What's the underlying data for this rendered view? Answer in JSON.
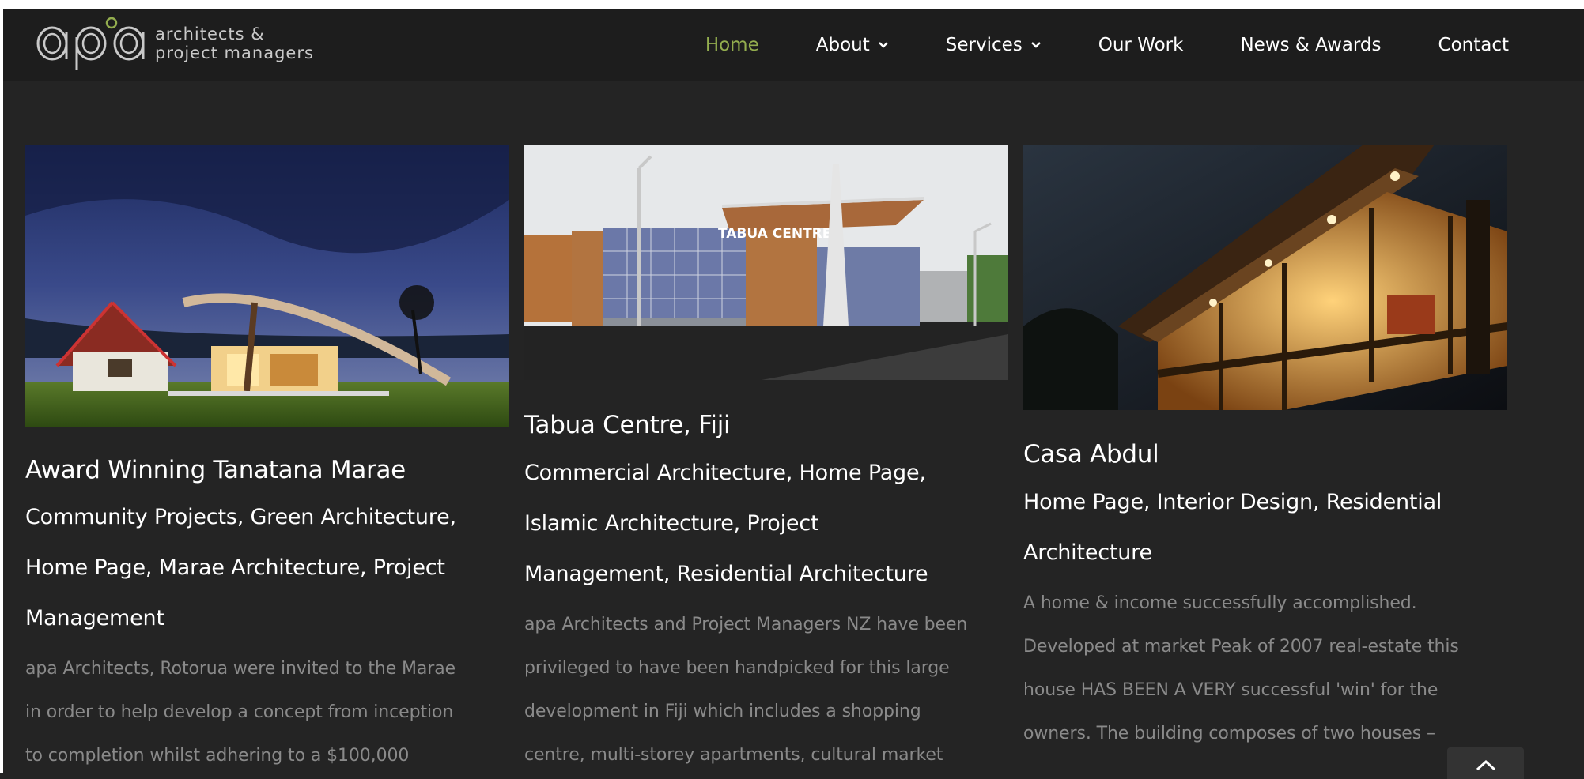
{
  "site": {
    "logo_mark": "apa",
    "logo_line1": "architects &",
    "logo_line2": "project managers"
  },
  "nav": {
    "items": [
      {
        "label": "Home",
        "active": true,
        "dropdown": false
      },
      {
        "label": "About",
        "active": false,
        "dropdown": true
      },
      {
        "label": "Services",
        "active": false,
        "dropdown": true
      },
      {
        "label": "Our Work",
        "active": false,
        "dropdown": false
      },
      {
        "label": "News & Awards",
        "active": false,
        "dropdown": false
      },
      {
        "label": "Contact",
        "active": false,
        "dropdown": false
      }
    ]
  },
  "colors": {
    "background": "#242424",
    "header": "#1d1d1d",
    "accent_green": "#93ad4e",
    "excerpt_gray": "#8a8a8a"
  },
  "posts": [
    {
      "title": "Award Winning Tanatana Marae",
      "categories_line1": "Community Projects, Green Architecture,",
      "categories_line2": "Home Page, Marae Architecture, Project",
      "categories_line3": "Management",
      "excerpt_line1": "apa Architects, Rotorua were invited to the Marae",
      "excerpt_line2": "in order to help develop a concept from inception",
      "excerpt_line3": "to completion whilst adhering to a $100,000"
    },
    {
      "title": "Tabua Centre, Fiji",
      "sign_text": "TABUA CENTRE",
      "categories_line1": "Commercial Architecture, Home Page,",
      "categories_line2": "Islamic Architecture, Project",
      "categories_line3": "Management, Residential Architecture",
      "excerpt_line1": "apa Architects and Project Managers NZ have been",
      "excerpt_line2": "privileged to have been handpicked for this large",
      "excerpt_line3": "development in Fiji which includes a shopping",
      "excerpt_line4": "centre, multi-storey apartments, cultural market"
    },
    {
      "title": "Casa Abdul",
      "categories_line1": "Home Page, Interior Design, Residential",
      "categories_line2": "Architecture",
      "excerpt_line1": "A home & income successfully accomplished.",
      "excerpt_line2": "Developed at market Peak of 2007 real-estate this",
      "excerpt_line3": "house HAS BEEN A VERY successful 'win' for the",
      "excerpt_line4": "owners. The building composes of two houses –"
    }
  ],
  "icons": {
    "chevron": "chevron-down-icon",
    "to_top": "chevron-up-icon"
  }
}
